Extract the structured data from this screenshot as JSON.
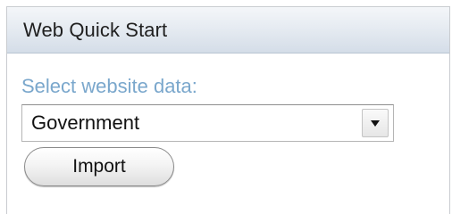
{
  "panel": {
    "title": "Web Quick Start",
    "field_label": "Select website data:",
    "select": {
      "selected_value": "Government",
      "arrow_icon": "triangle-down-icon"
    },
    "import_button_label": "Import"
  },
  "colors": {
    "label_text": "#7aa7cc",
    "header_gradient_top": "#f4f6f9",
    "header_gradient_bottom": "#d4dde8",
    "panel_border": "#c9ccd0"
  }
}
